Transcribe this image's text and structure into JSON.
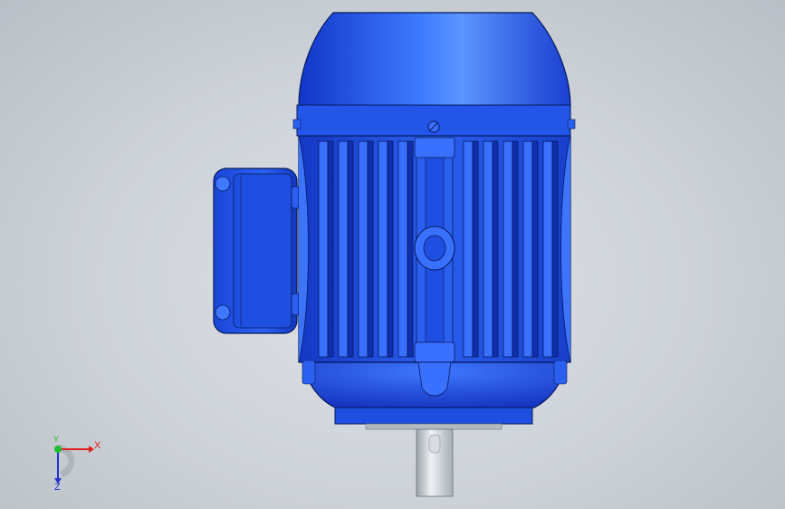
{
  "viewport": {
    "background_color": "#cdd2d8",
    "model": {
      "body_color": "#1f4fe0",
      "highlight_color": "#4f8cff",
      "shadow_color": "#0a2a9a",
      "outline_color": "#061a5a",
      "shaft_color": "#c9cfd6"
    },
    "triad": {
      "x_label": "X",
      "y_label": "Y",
      "z_label": "Z",
      "x_color": "#e0201c",
      "y_color": "#1fbf2a",
      "z_color": "#2032d0"
    }
  }
}
